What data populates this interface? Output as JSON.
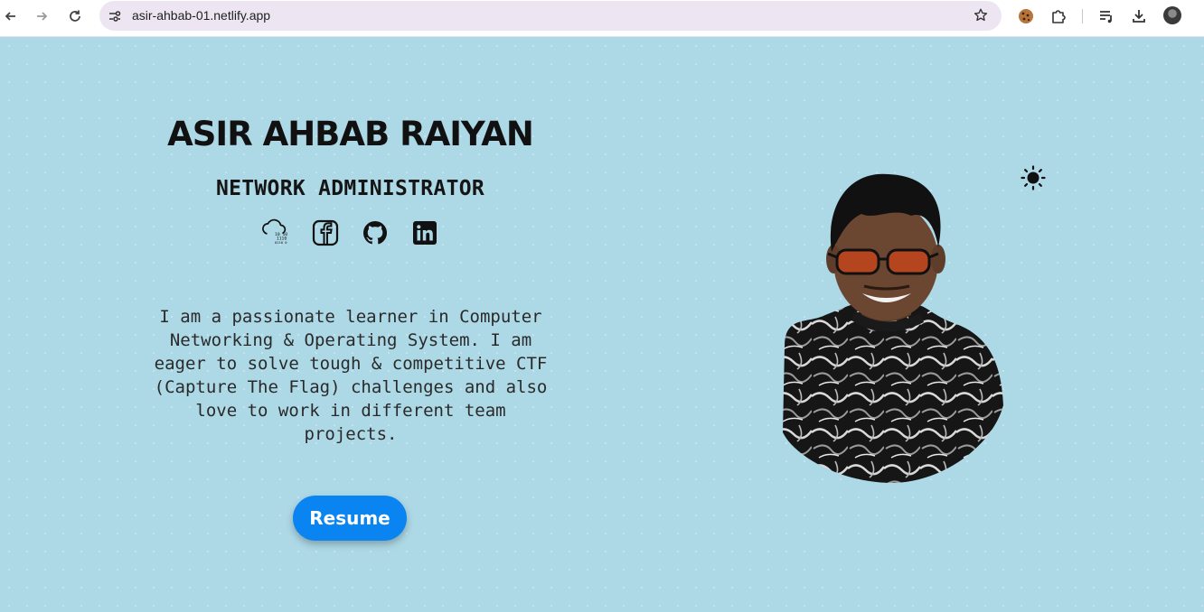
{
  "browser": {
    "url": "asir-ahbab-01.netlify.app",
    "icons": [
      "back-icon",
      "forward-icon",
      "reload-icon",
      "site-info-icon",
      "bookmark-star-icon",
      "cookie-icon",
      "extensions-icon",
      "reading-list-icon",
      "download-icon",
      "profile-avatar"
    ]
  },
  "hero": {
    "name": "ASIR AHBAB RAIYAN",
    "role": "NETWORK ADMINISTRATOR",
    "bio": "I am a passionate learner in Computer Networking & Operating System. I am eager to solve tough & competitive CTF (Capture The Flag) challenges and also love to work in different team projects.",
    "resume_label": "Resume",
    "social": [
      "cloud-binary-icon",
      "facebook-icon",
      "github-icon",
      "linkedin-icon"
    ]
  },
  "colors": {
    "background": "#ADD8E6",
    "button": "#0A84F0",
    "text": "#111111"
  }
}
